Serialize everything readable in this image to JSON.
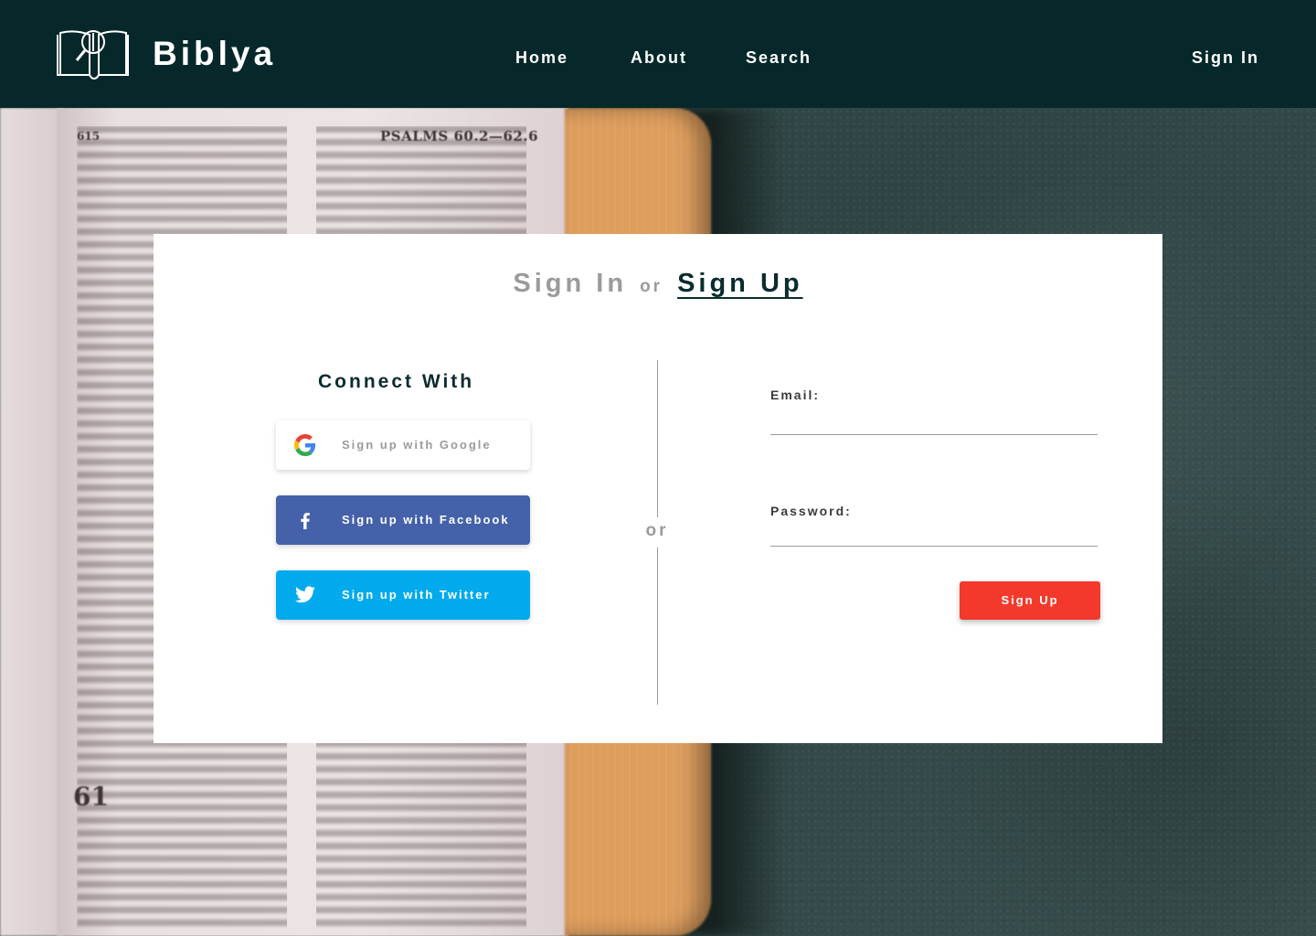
{
  "app": {
    "brand": "Biblya"
  },
  "nav": {
    "home": "Home",
    "about": "About",
    "search": "Search",
    "sign_in": "Sign In"
  },
  "background": {
    "psalm_header": "PSALMS 60.2—62.6",
    "page_number": "615",
    "chapter_number": "61"
  },
  "auth": {
    "tab_sign_in": "Sign In",
    "tab_separator": "or",
    "tab_sign_up": "Sign Up",
    "active_tab": "Sign Up",
    "connect_title": "Connect With",
    "google_label": "Sign up with Google",
    "facebook_label": "Sign up with Facebook",
    "twitter_label": "Sign up with Twitter",
    "divider_label": "or",
    "email_label": "Email:",
    "email_value": "",
    "password_label": "Password:",
    "password_value": "",
    "submit_label": "Sign Up"
  },
  "colors": {
    "header_bg": "#06282b",
    "facebook": "#4461aa",
    "twitter": "#00aaec",
    "submit": "#f2392c",
    "active_tab": "#0a2c2e",
    "muted": "#9b9b9b"
  },
  "icons": {
    "logo": "open-book-magnifier-icon",
    "google": "google-icon",
    "facebook": "facebook-icon",
    "twitter": "twitter-icon"
  }
}
